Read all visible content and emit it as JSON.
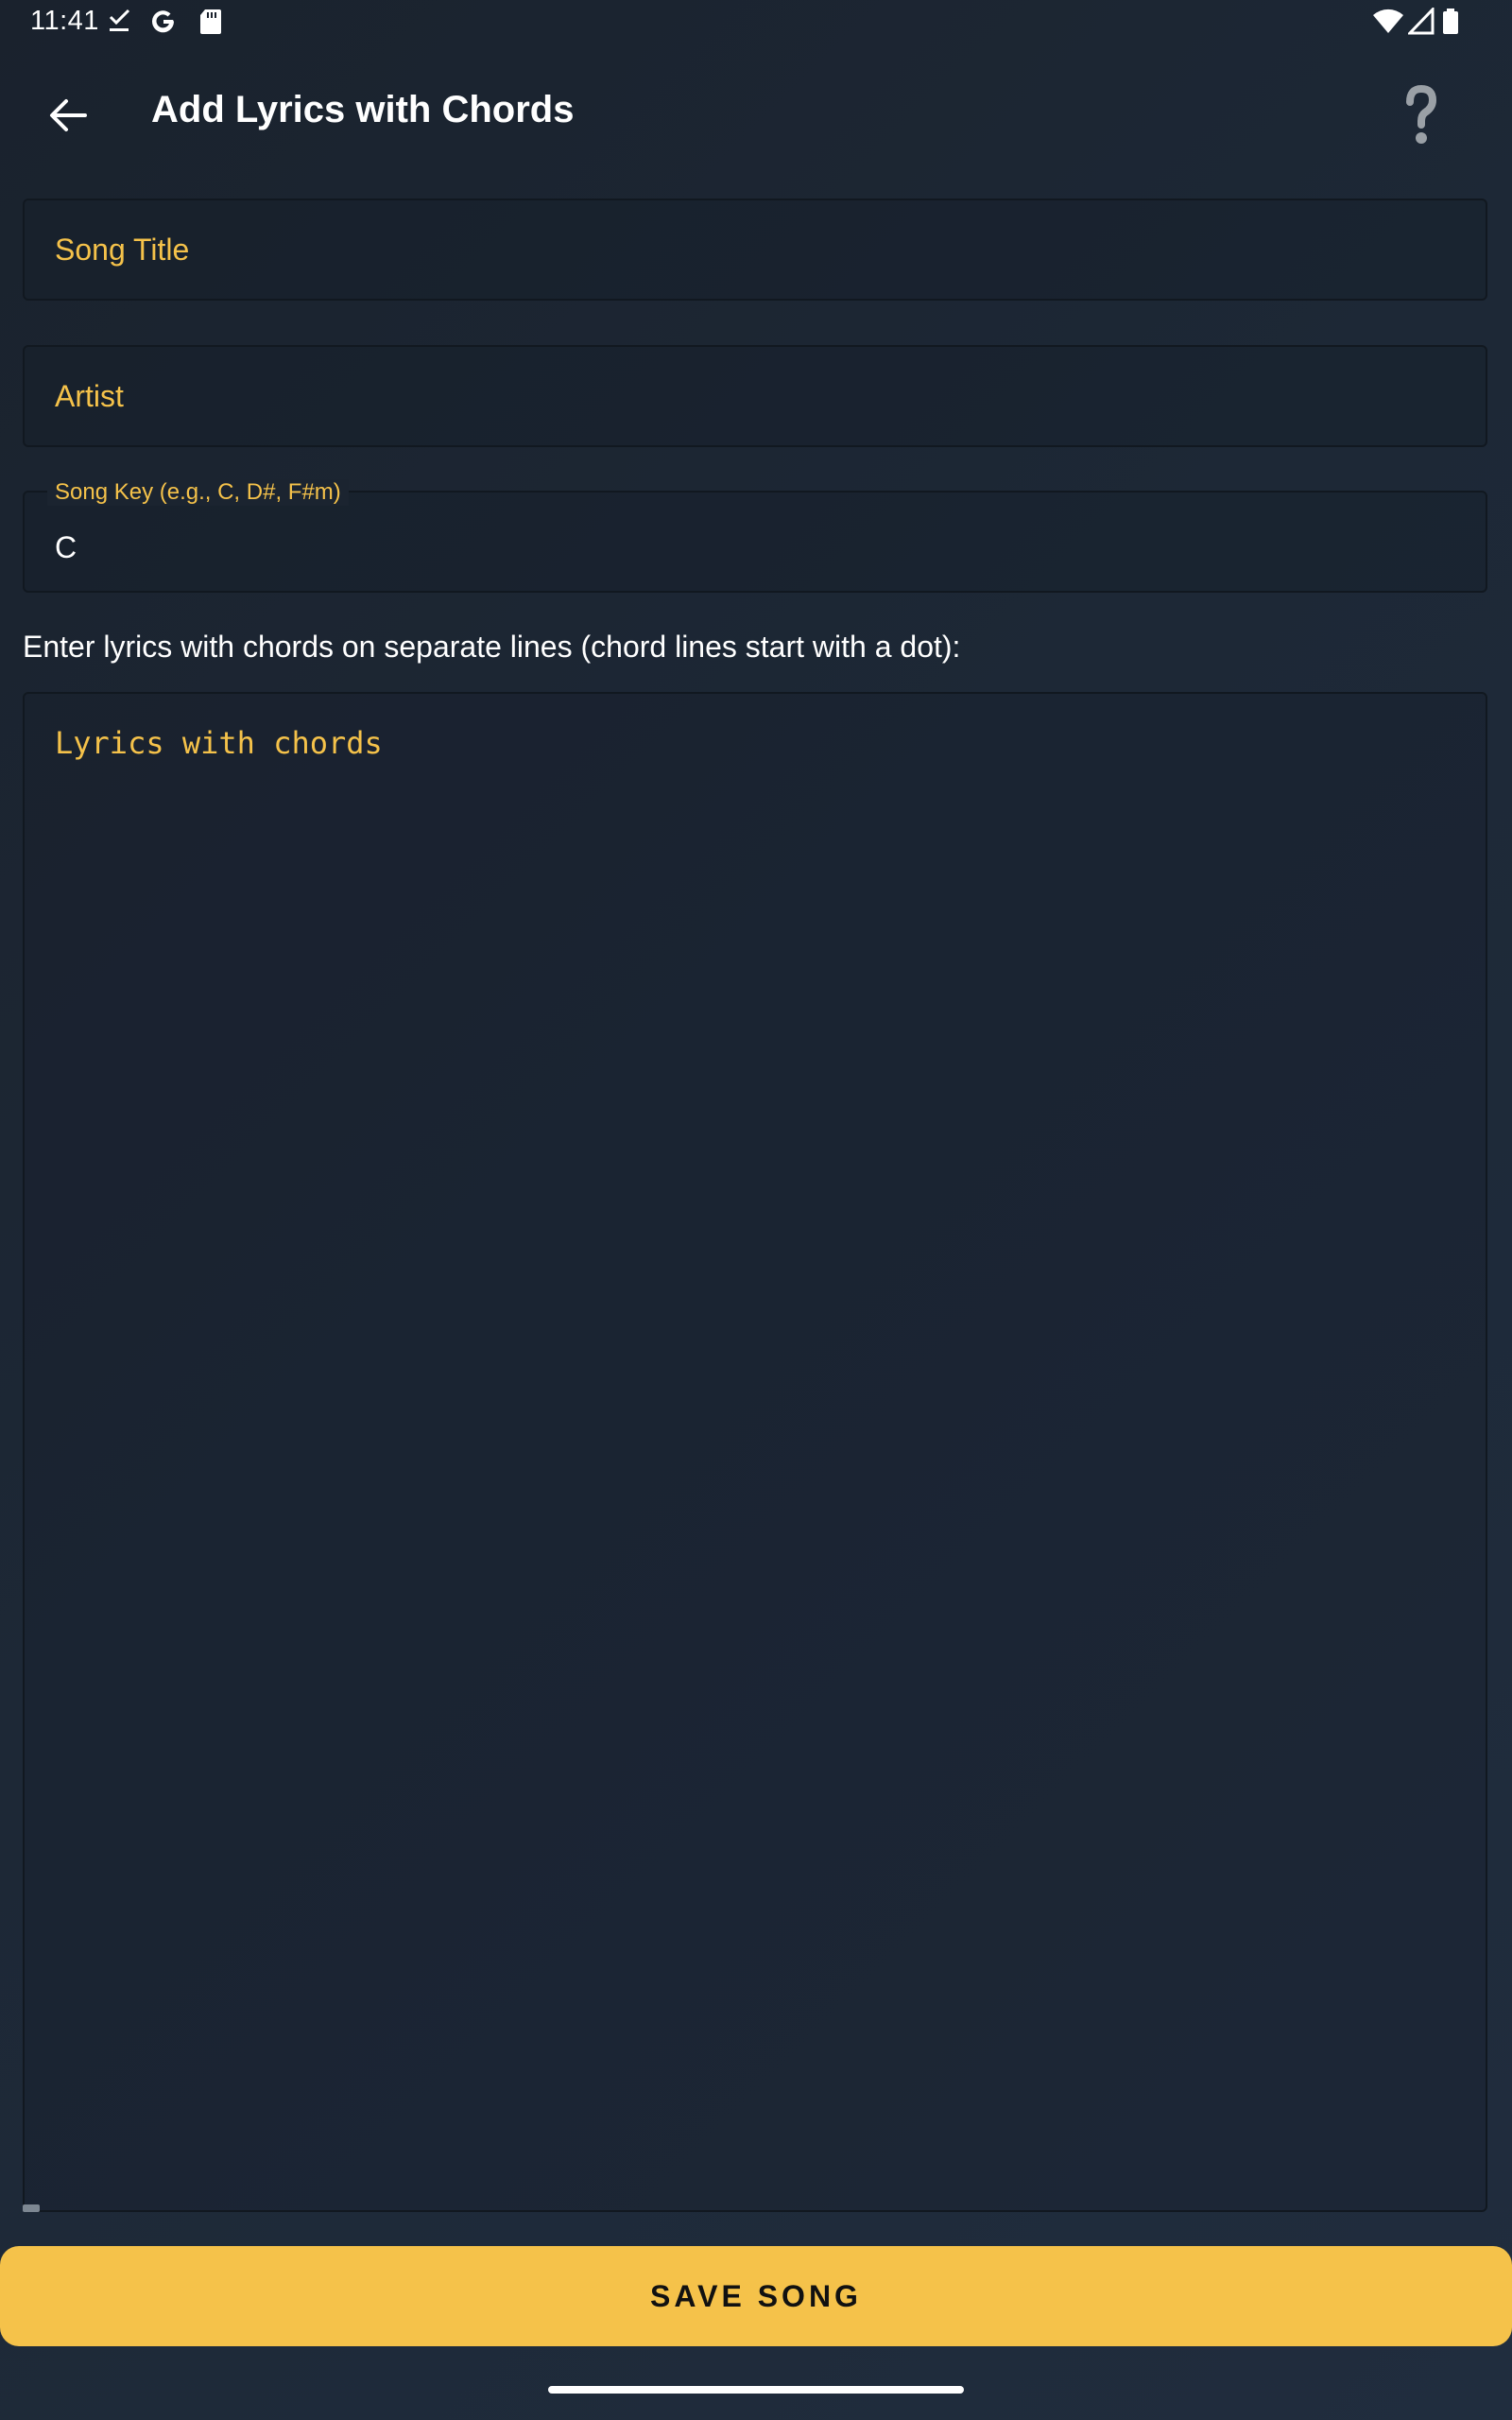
{
  "status_bar": {
    "time": "11:41",
    "icons_left": [
      "download-done-icon",
      "google-icon",
      "sd-card-icon"
    ],
    "icons_right": [
      "wifi-icon",
      "cell-signal-icon",
      "battery-icon"
    ]
  },
  "app_bar": {
    "title": "Add Lyrics with Chords",
    "back_icon": "arrow-back-icon",
    "help_icon": "help-question-icon"
  },
  "form": {
    "song_title": {
      "placeholder": "Song Title",
      "value": ""
    },
    "artist": {
      "placeholder": "Artist",
      "value": ""
    },
    "song_key": {
      "label": "Song Key (e.g., C, D#, F#m)",
      "value": "C"
    },
    "instructions": "Enter lyrics with chords on separate lines (chord lines start with a dot):",
    "lyrics": {
      "placeholder": "Lyrics with chords",
      "value": ""
    }
  },
  "actions": {
    "save_label": "SAVE SONG"
  },
  "colors": {
    "accent": "#f5c24a",
    "background": "#1d2836",
    "text": "#ffffff"
  }
}
